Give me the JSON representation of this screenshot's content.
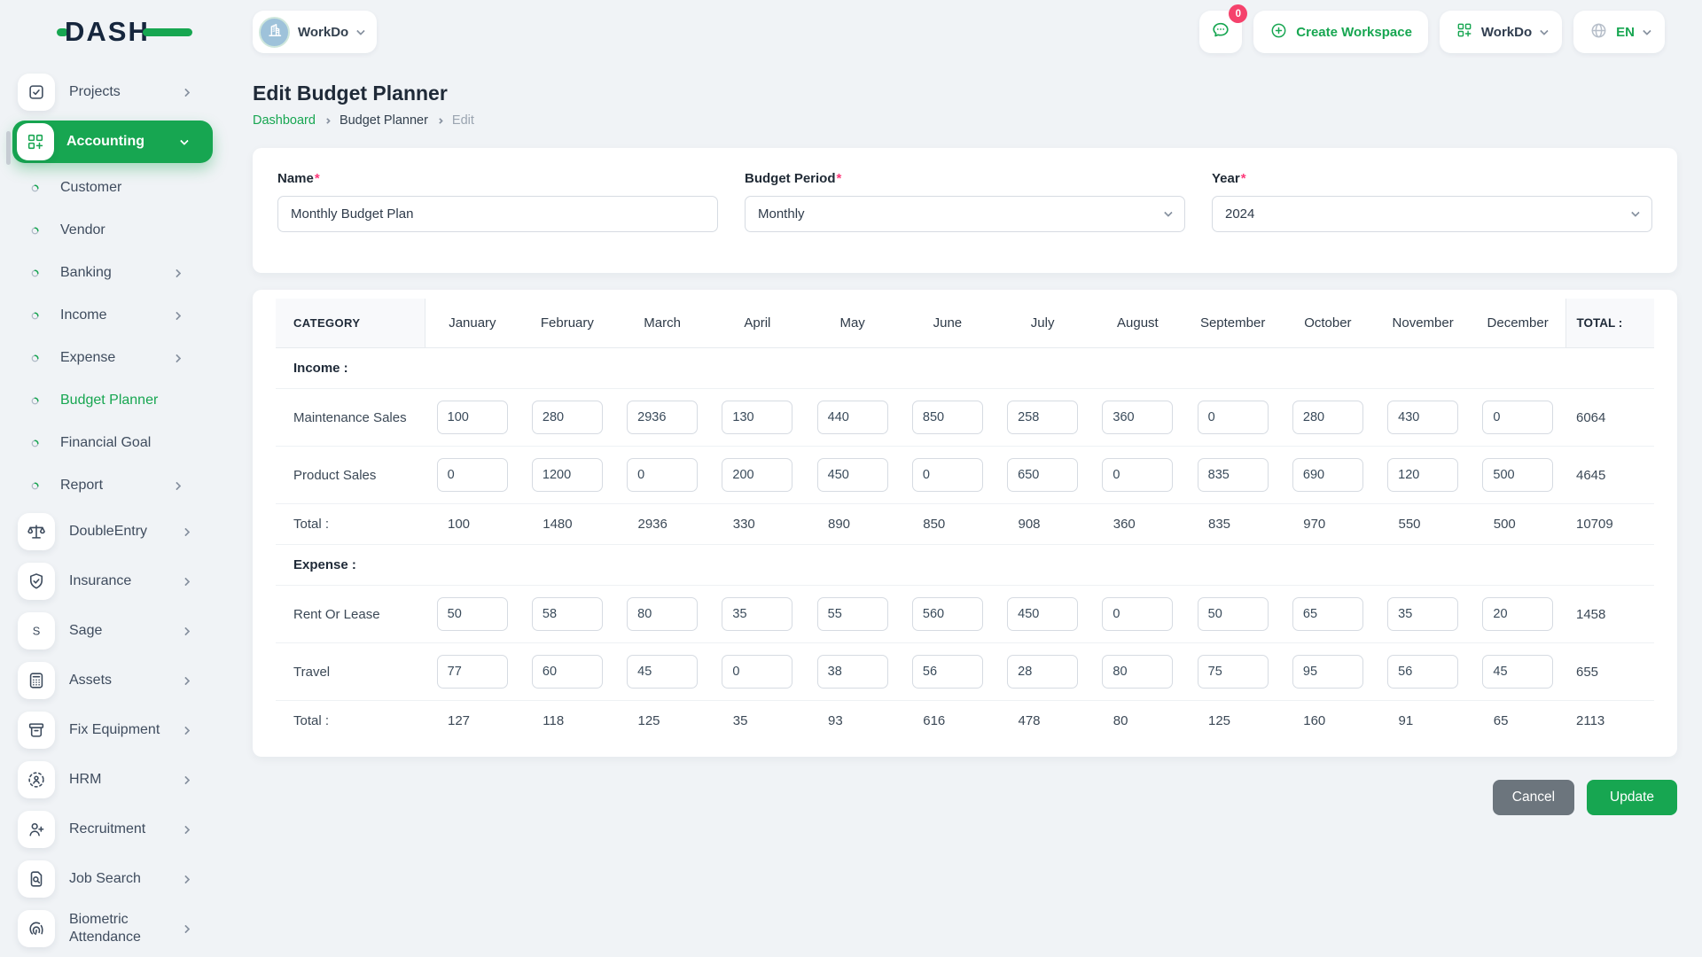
{
  "brand": {
    "logo_text": "DASH"
  },
  "topbar": {
    "workspace_label": "WorkDo",
    "messages_badge": "0",
    "create_workspace_label": "Create Workspace",
    "workdo_label": "WorkDo",
    "language": "EN"
  },
  "sidebar": {
    "items": [
      {
        "label": "Projects",
        "icon": "checkbox",
        "type": "top",
        "chevron": "right"
      },
      {
        "label": "Accounting",
        "icon": "gridplus",
        "type": "top",
        "chevron": "down",
        "active": true
      },
      {
        "label": "Customer",
        "icon": "dot",
        "type": "sub",
        "chevron": ""
      },
      {
        "label": "Vendor",
        "icon": "dot",
        "type": "sub",
        "chevron": ""
      },
      {
        "label": "Banking",
        "icon": "dot",
        "type": "sub",
        "chevron": "right"
      },
      {
        "label": "Income",
        "icon": "dot",
        "type": "sub",
        "chevron": "right"
      },
      {
        "label": "Expense",
        "icon": "dot",
        "type": "sub",
        "chevron": "right"
      },
      {
        "label": "Budget Planner",
        "icon": "dot",
        "type": "sub",
        "chevron": "",
        "current": true
      },
      {
        "label": "Financial Goal",
        "icon": "dot",
        "type": "sub",
        "chevron": ""
      },
      {
        "label": "Report",
        "icon": "dot",
        "type": "sub",
        "chevron": "right"
      },
      {
        "label": "DoubleEntry",
        "icon": "scales",
        "type": "top",
        "chevron": "right"
      },
      {
        "label": "Insurance",
        "icon": "shield",
        "type": "top",
        "chevron": "right"
      },
      {
        "label": "Sage",
        "icon": "letterS",
        "type": "top",
        "chevron": "right"
      },
      {
        "label": "Assets",
        "icon": "calculator",
        "type": "top",
        "chevron": "right"
      },
      {
        "label": "Fix Equipment",
        "icon": "archive",
        "type": "top",
        "chevron": "right"
      },
      {
        "label": "HRM",
        "icon": "hrm",
        "type": "top",
        "chevron": "right"
      },
      {
        "label": "Recruitment",
        "icon": "personplus",
        "type": "top",
        "chevron": "right"
      },
      {
        "label": "Job Search",
        "icon": "docsearch",
        "type": "top",
        "chevron": "right"
      },
      {
        "label": "Biometric Attendance",
        "icon": "fingerprint",
        "type": "top",
        "chevron": "right"
      }
    ]
  },
  "page": {
    "title": "Edit Budget Planner",
    "breadcrumb": [
      "Dashboard",
      "Budget Planner",
      "Edit"
    ]
  },
  "form": {
    "required_mark": "*",
    "name": {
      "label": "Name",
      "value": "Monthly Budget Plan"
    },
    "period": {
      "label": "Budget Period",
      "value": "Monthly"
    },
    "year": {
      "label": "Year",
      "value": "2024"
    }
  },
  "table": {
    "category_header": "CATEGORY",
    "months": [
      "January",
      "February",
      "March",
      "April",
      "May",
      "June",
      "July",
      "August",
      "September",
      "October",
      "November",
      "December"
    ],
    "total_header": "TOTAL :",
    "sections": [
      {
        "title": "Income :",
        "rows": [
          {
            "label": "Maintenance Sales",
            "values": [
              "100",
              "280",
              "2936",
              "130",
              "440",
              "850",
              "258",
              "360",
              "0",
              "280",
              "430",
              "0"
            ],
            "total": "6064"
          },
          {
            "label": "Product Sales",
            "values": [
              "0",
              "1200",
              "0",
              "200",
              "450",
              "0",
              "650",
              "0",
              "835",
              "690",
              "120",
              "500"
            ],
            "total": "4645"
          }
        ],
        "total_row": {
          "label": "Total :",
          "values": [
            "100",
            "1480",
            "2936",
            "330",
            "890",
            "850",
            "908",
            "360",
            "835",
            "970",
            "550",
            "500"
          ],
          "total": "10709"
        }
      },
      {
        "title": "Expense :",
        "rows": [
          {
            "label": "Rent Or Lease",
            "values": [
              "50",
              "58",
              "80",
              "35",
              "55",
              "560",
              "450",
              "0",
              "50",
              "65",
              "35",
              "20"
            ],
            "total": "1458"
          },
          {
            "label": "Travel",
            "values": [
              "77",
              "60",
              "45",
              "0",
              "38",
              "56",
              "28",
              "80",
              "75",
              "95",
              "56",
              "45"
            ],
            "total": "655"
          }
        ],
        "total_row": {
          "label": "Total :",
          "values": [
            "127",
            "118",
            "125",
            "35",
            "93",
            "616",
            "478",
            "80",
            "125",
            "160",
            "91",
            "65"
          ],
          "total": "2113"
        }
      }
    ]
  },
  "actions": {
    "cancel_label": "Cancel",
    "update_label": "Update"
  },
  "colors": {
    "accent_green": "#17a651",
    "badge_pink": "#f5426c",
    "navy": "#16263d",
    "cancel_gray": "#6c757d"
  }
}
